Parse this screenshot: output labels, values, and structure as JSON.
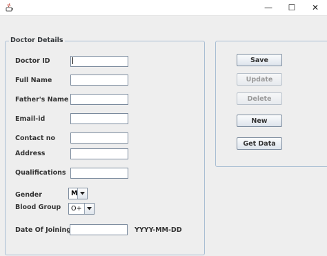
{
  "window": {
    "icon": "java-cup-icon",
    "minimize_glyph": "—",
    "maximize_glyph": "☐",
    "close_glyph": "✕"
  },
  "form": {
    "legend": "Doctor Details",
    "fields": {
      "doctor_id": {
        "label": "Doctor ID",
        "value": ""
      },
      "full_name": {
        "label": "Full Name",
        "value": ""
      },
      "fathers_name": {
        "label": "Father's Name",
        "value": ""
      },
      "email": {
        "label": "Email-id",
        "value": ""
      },
      "contact": {
        "label": "Contact no",
        "value": ""
      },
      "address": {
        "label": "Address",
        "value": ""
      },
      "qualifications": {
        "label": "Qualifications",
        "value": ""
      },
      "gender": {
        "label": "Gender",
        "value": "M"
      },
      "blood_group": {
        "label": "Blood Group",
        "value": "O+"
      },
      "date_of_joining": {
        "label": "Date Of Joining",
        "value": "",
        "hint": "YYYY-MM-DD"
      }
    }
  },
  "actions": {
    "save": "Save",
    "update": "Update",
    "delete": "Delete",
    "new": "New",
    "get_data": "Get Data"
  },
  "colors": {
    "panel_border": "#a8bdd3",
    "background": "#eeeeee"
  }
}
